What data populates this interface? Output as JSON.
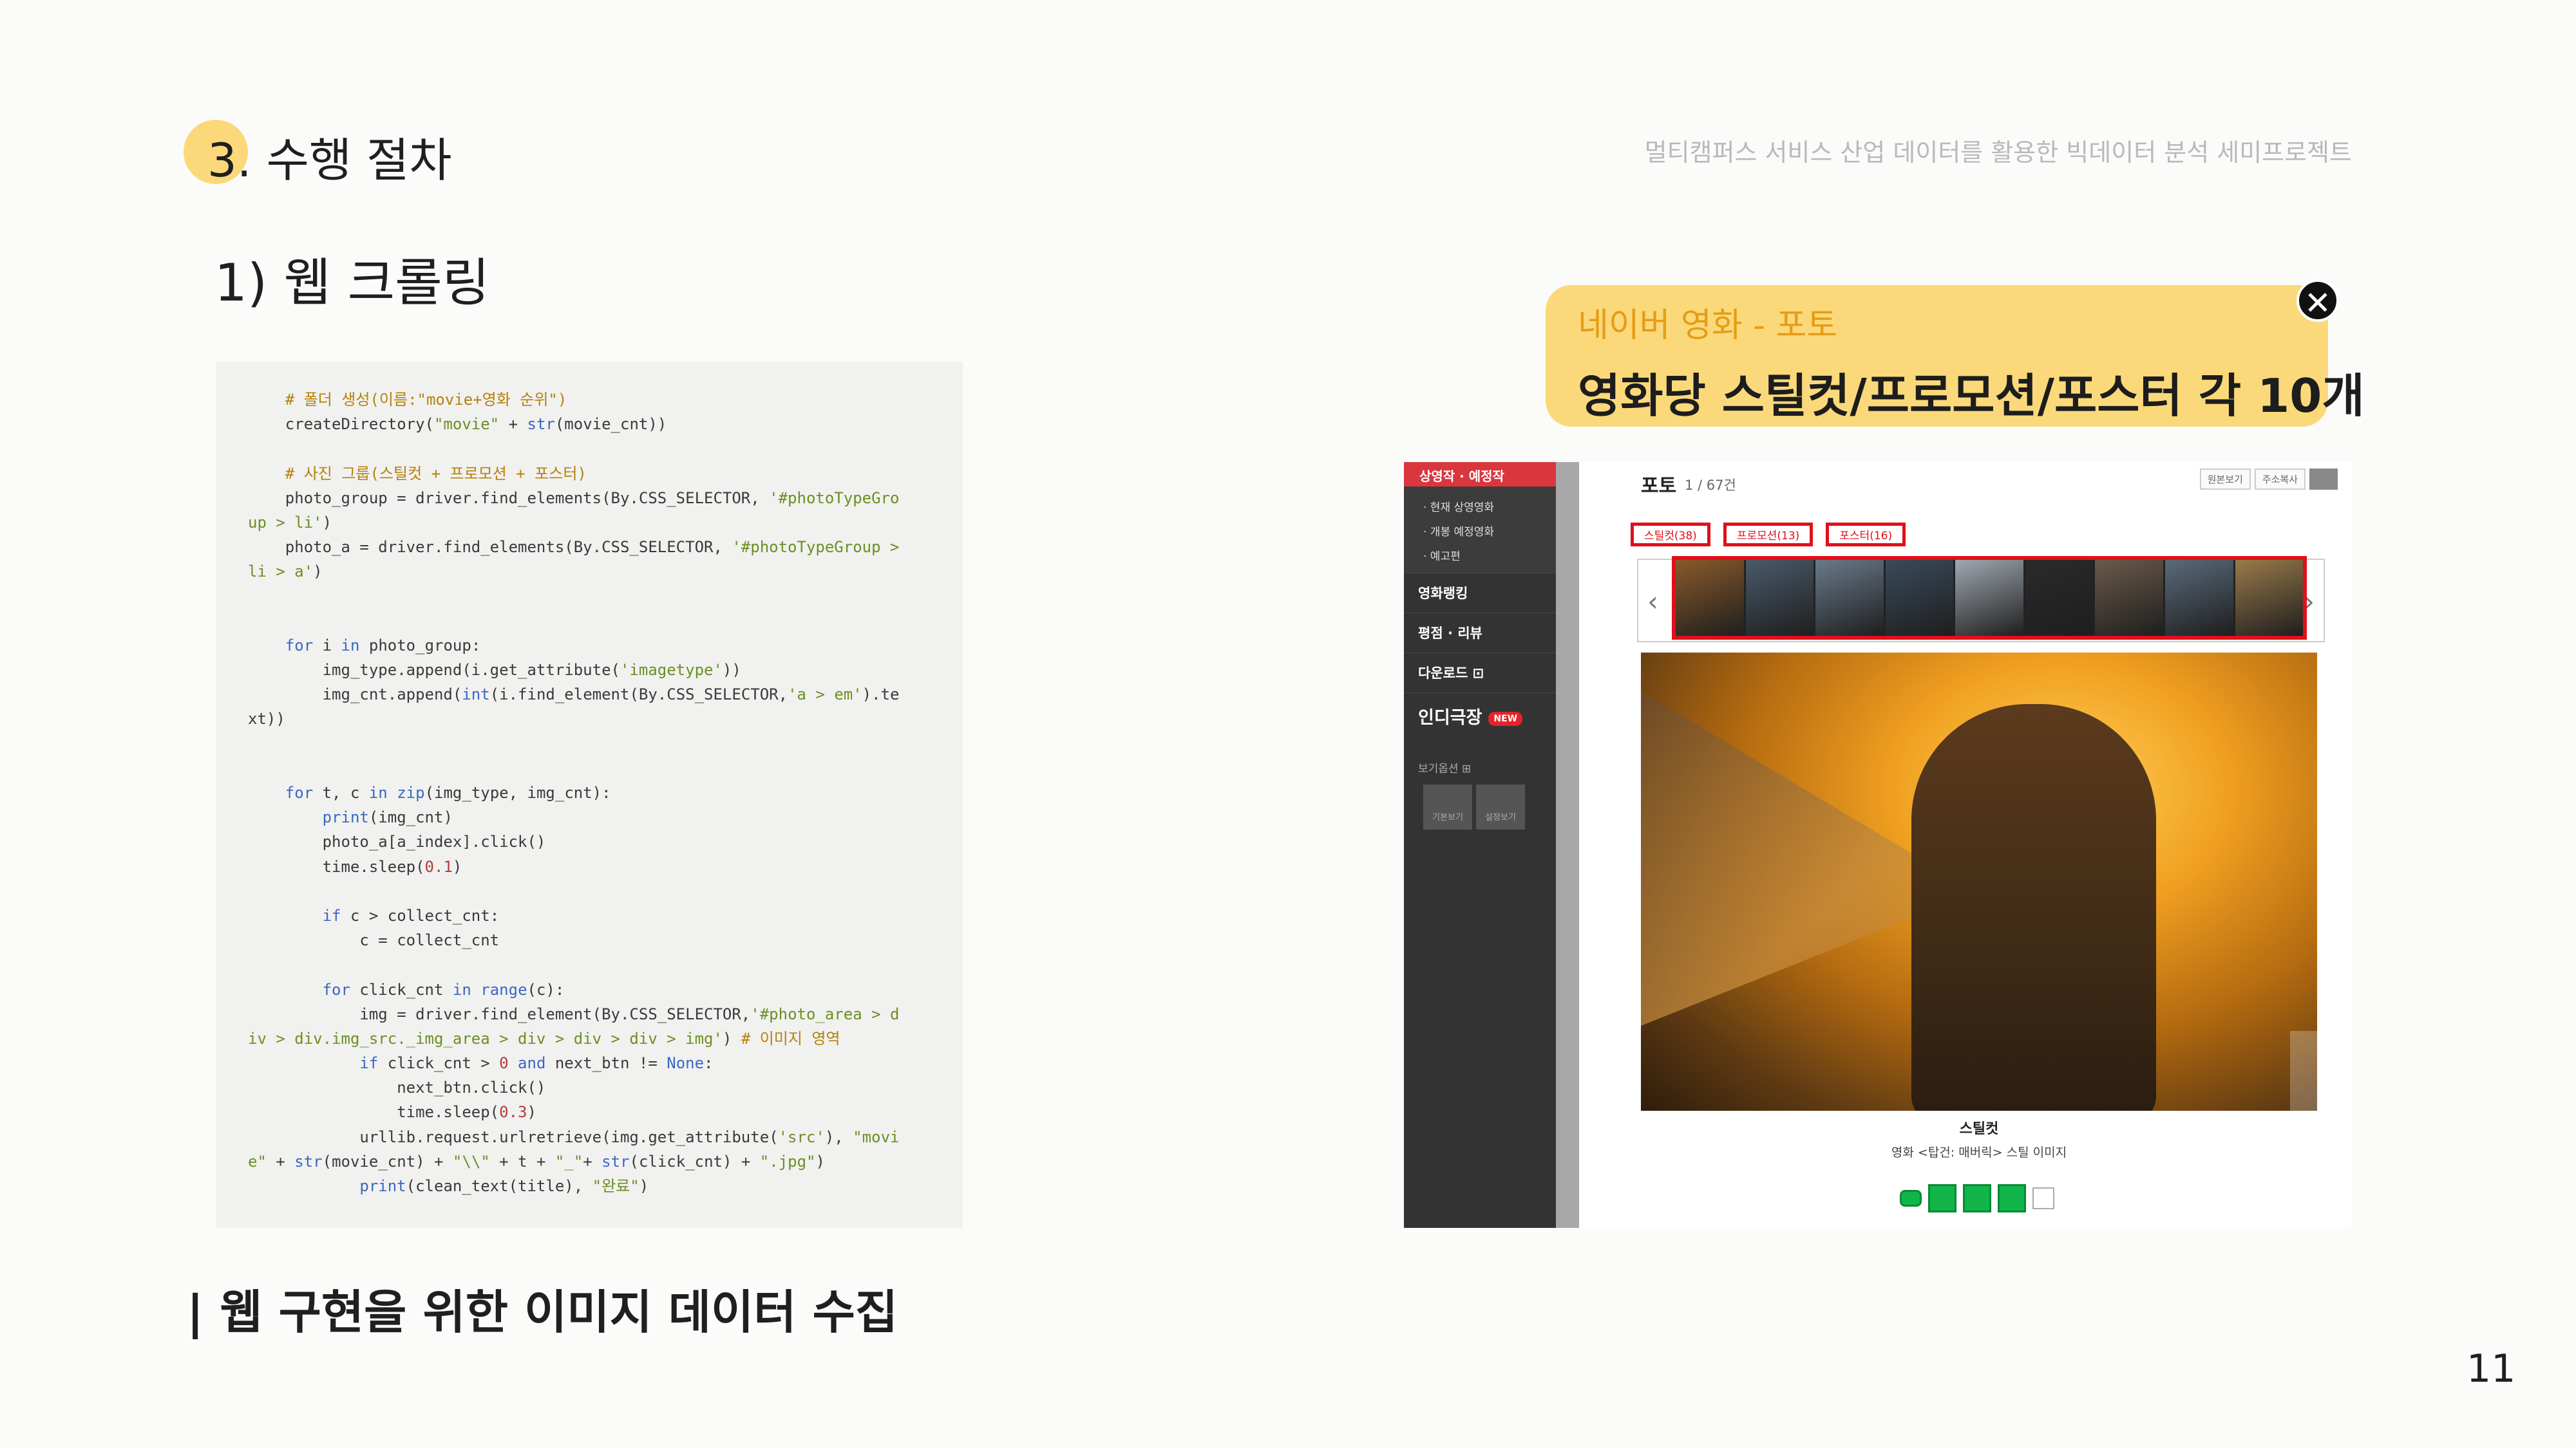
{
  "header": {
    "section_title": "3. 수행 절차",
    "subtitle_right": "멀티캠퍼스 서비스 산업 데이터를 활용한 빅데이터 분석 세미프로젝트",
    "step_title": "1) 웹 크롤링"
  },
  "callout": {
    "subtitle": "네이버 영화 - 포토",
    "title": "영화당 스틸컷/프로모션/포스터 각 10개",
    "close_icon": "close-icon"
  },
  "code": {
    "lines": [
      [
        {
          "t": "    # 폴더 생성(이름:\"movie+영화 순위\")",
          "c": "cm"
        }
      ],
      [
        {
          "t": "    createDirectory(",
          "c": ""
        },
        {
          "t": "\"movie\"",
          "c": "str"
        },
        {
          "t": " + ",
          "c": ""
        },
        {
          "t": "str",
          "c": "kw"
        },
        {
          "t": "(movie_cnt))",
          "c": ""
        }
      ],
      [
        {
          "t": "",
          "c": ""
        }
      ],
      [
        {
          "t": "    # 사진 그룹(스틸컷 + 프로모션 + 포스터)",
          "c": "cm"
        }
      ],
      [
        {
          "t": "    photo_group = driver.find_elements(By.CSS_SELECTOR, ",
          "c": ""
        },
        {
          "t": "'#photoTypeGro",
          "c": "str"
        }
      ],
      [
        {
          "t": "up > li'",
          "c": "str"
        },
        {
          "t": ")",
          "c": ""
        }
      ],
      [
        {
          "t": "    photo_a = driver.find_elements(By.CSS_SELECTOR, ",
          "c": ""
        },
        {
          "t": "'#photoTypeGroup >",
          "c": "str"
        }
      ],
      [
        {
          "t": "li > a'",
          "c": "str"
        },
        {
          "t": ")",
          "c": ""
        }
      ],
      [
        {
          "t": "",
          "c": ""
        }
      ],
      [
        {
          "t": "",
          "c": ""
        }
      ],
      [
        {
          "t": "    ",
          "c": ""
        },
        {
          "t": "for",
          "c": "kw"
        },
        {
          "t": " i ",
          "c": ""
        },
        {
          "t": "in",
          "c": "kw"
        },
        {
          "t": " photo_group:",
          "c": ""
        }
      ],
      [
        {
          "t": "        img_type.append(i.get_attribute(",
          "c": ""
        },
        {
          "t": "'imagetype'",
          "c": "str"
        },
        {
          "t": "))",
          "c": ""
        }
      ],
      [
        {
          "t": "        img_cnt.append(",
          "c": ""
        },
        {
          "t": "int",
          "c": "kw"
        },
        {
          "t": "(i.find_element(By.CSS_SELECTOR,",
          "c": ""
        },
        {
          "t": "'a > em'",
          "c": "str"
        },
        {
          "t": ").te",
          "c": ""
        }
      ],
      [
        {
          "t": "xt))",
          "c": ""
        }
      ],
      [
        {
          "t": "",
          "c": ""
        }
      ],
      [
        {
          "t": "",
          "c": ""
        }
      ],
      [
        {
          "t": "    ",
          "c": ""
        },
        {
          "t": "for",
          "c": "kw"
        },
        {
          "t": " t, c ",
          "c": ""
        },
        {
          "t": "in",
          "c": "kw"
        },
        {
          "t": " ",
          "c": ""
        },
        {
          "t": "zip",
          "c": "kw"
        },
        {
          "t": "(img_type, img_cnt):",
          "c": ""
        }
      ],
      [
        {
          "t": "        ",
          "c": ""
        },
        {
          "t": "print",
          "c": "kw"
        },
        {
          "t": "(img_cnt)",
          "c": ""
        }
      ],
      [
        {
          "t": "        photo_a[a_index].click()",
          "c": ""
        }
      ],
      [
        {
          "t": "        time.sleep(",
          "c": ""
        },
        {
          "t": "0.1",
          "c": "num"
        },
        {
          "t": ")",
          "c": ""
        }
      ],
      [
        {
          "t": "",
          "c": ""
        }
      ],
      [
        {
          "t": "        ",
          "c": ""
        },
        {
          "t": "if",
          "c": "kw"
        },
        {
          "t": " c > collect_cnt:",
          "c": ""
        }
      ],
      [
        {
          "t": "            c = collect_cnt",
          "c": ""
        }
      ],
      [
        {
          "t": "",
          "c": ""
        }
      ],
      [
        {
          "t": "        ",
          "c": ""
        },
        {
          "t": "for",
          "c": "kw"
        },
        {
          "t": " click_cnt ",
          "c": ""
        },
        {
          "t": "in",
          "c": "kw"
        },
        {
          "t": " ",
          "c": ""
        },
        {
          "t": "range",
          "c": "kw"
        },
        {
          "t": "(c):",
          "c": ""
        }
      ],
      [
        {
          "t": "            img = driver.find_element(By.CSS_SELECTOR,",
          "c": ""
        },
        {
          "t": "'#photo_area > d",
          "c": "str"
        }
      ],
      [
        {
          "t": "iv > div.img_src._img_area > div > div > div > img'",
          "c": "str"
        },
        {
          "t": ") ",
          "c": ""
        },
        {
          "t": "# 이미지 영역",
          "c": "cm"
        }
      ],
      [
        {
          "t": "            ",
          "c": ""
        },
        {
          "t": "if",
          "c": "kw"
        },
        {
          "t": " click_cnt > ",
          "c": ""
        },
        {
          "t": "0",
          "c": "num"
        },
        {
          "t": " ",
          "c": ""
        },
        {
          "t": "and",
          "c": "kw"
        },
        {
          "t": " next_btn != ",
          "c": ""
        },
        {
          "t": "None",
          "c": "kw"
        },
        {
          "t": ":",
          "c": ""
        }
      ],
      [
        {
          "t": "                next_btn.click()",
          "c": ""
        }
      ],
      [
        {
          "t": "                time.sleep(",
          "c": ""
        },
        {
          "t": "0.3",
          "c": "num"
        },
        {
          "t": ")",
          "c": ""
        }
      ],
      [
        {
          "t": "            urllib.request.urlretrieve(img.get_attribute(",
          "c": ""
        },
        {
          "t": "'src'",
          "c": "str"
        },
        {
          "t": "), ",
          "c": ""
        },
        {
          "t": "\"movi",
          "c": "str"
        }
      ],
      [
        {
          "t": "e\"",
          "c": "str"
        },
        {
          "t": " + ",
          "c": ""
        },
        {
          "t": "str",
          "c": "kw"
        },
        {
          "t": "(movie_cnt) + ",
          "c": ""
        },
        {
          "t": "\"\\\\\"",
          "c": "str"
        },
        {
          "t": " + t + ",
          "c": ""
        },
        {
          "t": "\"_\"",
          "c": "str"
        },
        {
          "t": "+ ",
          "c": ""
        },
        {
          "t": "str",
          "c": "kw"
        },
        {
          "t": "(click_cnt) + ",
          "c": ""
        },
        {
          "t": "\".jpg\"",
          "c": "str"
        },
        {
          "t": ")",
          "c": ""
        }
      ],
      [
        {
          "t": "            ",
          "c": ""
        },
        {
          "t": "print",
          "c": "kw"
        },
        {
          "t": "(clean_text(title), ",
          "c": ""
        },
        {
          "t": "\"완료\"",
          "c": "str"
        },
        {
          "t": ")",
          "c": ""
        }
      ]
    ]
  },
  "bottom_caption": "| 웹 구현을 위한 이미지 데이터 수집",
  "naver": {
    "sidebar_head": "상영작 · 예정작",
    "sidebar_sub": [
      "· 현재 상영영화",
      "· 개봉 예정영화",
      "· 예고편"
    ],
    "menu": [
      "영화랭킹",
      "평점 · 리뷰",
      "다운로드 ⊡"
    ],
    "menu_big": "인디극장",
    "menu_big_badge": "NEW",
    "option_label": "보기옵션 ⊞",
    "option_boxes": [
      "기본보기",
      "설정보기"
    ],
    "photo_title": "포토",
    "photo_count": "1 / 67건",
    "tools": [
      "원본보기",
      "주소복사"
    ],
    "tabs": [
      "스틸컷(38)",
      "프로모션(13)",
      "포스터(16)"
    ],
    "arrow_left": "‹",
    "arrow_right": "›",
    "next_button": "›",
    "caption_title": "스틸컷",
    "caption_sub": "영화 <탑건: 매버릭> 스틸 이미지",
    "thumb_colors": [
      "#8a5a2a",
      "#4a5a6a",
      "#6a7a8a",
      "#3a4a5a",
      "#a0a8b0",
      "#2a2a2a",
      "#6a5a4a",
      "#5a6a7a",
      "#9a7a4a"
    ]
  },
  "page_number": "11"
}
